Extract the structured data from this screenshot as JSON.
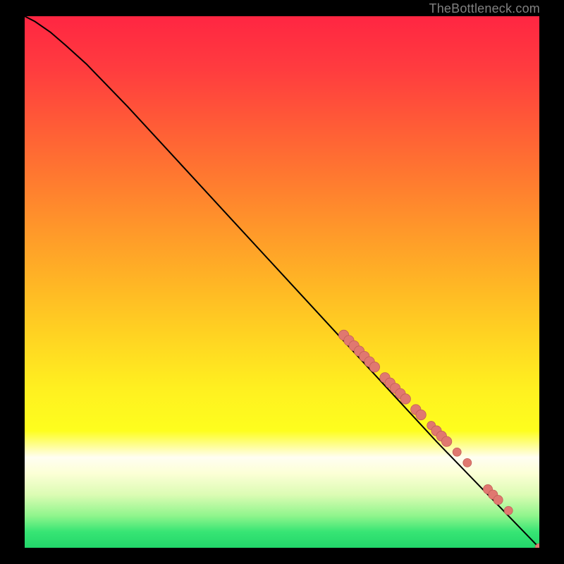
{
  "attribution": "TheBottleneck.com",
  "colors": {
    "background": "#000000",
    "curve": "#000000",
    "marker_fill": "#e07870",
    "marker_stroke": "#c26058"
  },
  "chart_data": {
    "type": "line",
    "title": "",
    "xlabel": "",
    "ylabel": "",
    "xlim": [
      0,
      100
    ],
    "ylim": [
      0,
      100
    ],
    "grid": false,
    "legend": false,
    "series": [
      {
        "name": "curve",
        "x": [
          0,
          2,
          5,
          8,
          12,
          20,
          30,
          40,
          50,
          60,
          70,
          80,
          90,
          100
        ],
        "y": [
          100,
          99,
          97,
          94.5,
          91,
          83,
          72.5,
          62,
          51.5,
          41,
          30.5,
          20,
          10,
          0
        ]
      }
    ],
    "markers": [
      {
        "x": 62,
        "y": 40,
        "r": 1.2
      },
      {
        "x": 63,
        "y": 39,
        "r": 1.2
      },
      {
        "x": 64,
        "y": 38,
        "r": 1.2
      },
      {
        "x": 65,
        "y": 37,
        "r": 1.2
      },
      {
        "x": 66,
        "y": 36,
        "r": 1.2
      },
      {
        "x": 67,
        "y": 35,
        "r": 1.2
      },
      {
        "x": 68,
        "y": 34,
        "r": 1.2
      },
      {
        "x": 70,
        "y": 32,
        "r": 1.2
      },
      {
        "x": 71,
        "y": 31,
        "r": 1.2
      },
      {
        "x": 72,
        "y": 30,
        "r": 1.2
      },
      {
        "x": 73,
        "y": 29,
        "r": 1.2
      },
      {
        "x": 74,
        "y": 28,
        "r": 1.2
      },
      {
        "x": 76,
        "y": 26,
        "r": 1.2
      },
      {
        "x": 77,
        "y": 25,
        "r": 1.2
      },
      {
        "x": 79,
        "y": 23,
        "r": 1.0
      },
      {
        "x": 80,
        "y": 22,
        "r": 1.2
      },
      {
        "x": 81,
        "y": 21,
        "r": 1.2
      },
      {
        "x": 82,
        "y": 20,
        "r": 1.2
      },
      {
        "x": 84,
        "y": 18,
        "r": 1.0
      },
      {
        "x": 86,
        "y": 16,
        "r": 1.0
      },
      {
        "x": 90,
        "y": 11,
        "r": 1.1
      },
      {
        "x": 91,
        "y": 10,
        "r": 1.1
      },
      {
        "x": 92,
        "y": 9,
        "r": 1.1
      },
      {
        "x": 94,
        "y": 7,
        "r": 1.0
      },
      {
        "x": 100,
        "y": 0,
        "r": 1.0
      }
    ]
  }
}
